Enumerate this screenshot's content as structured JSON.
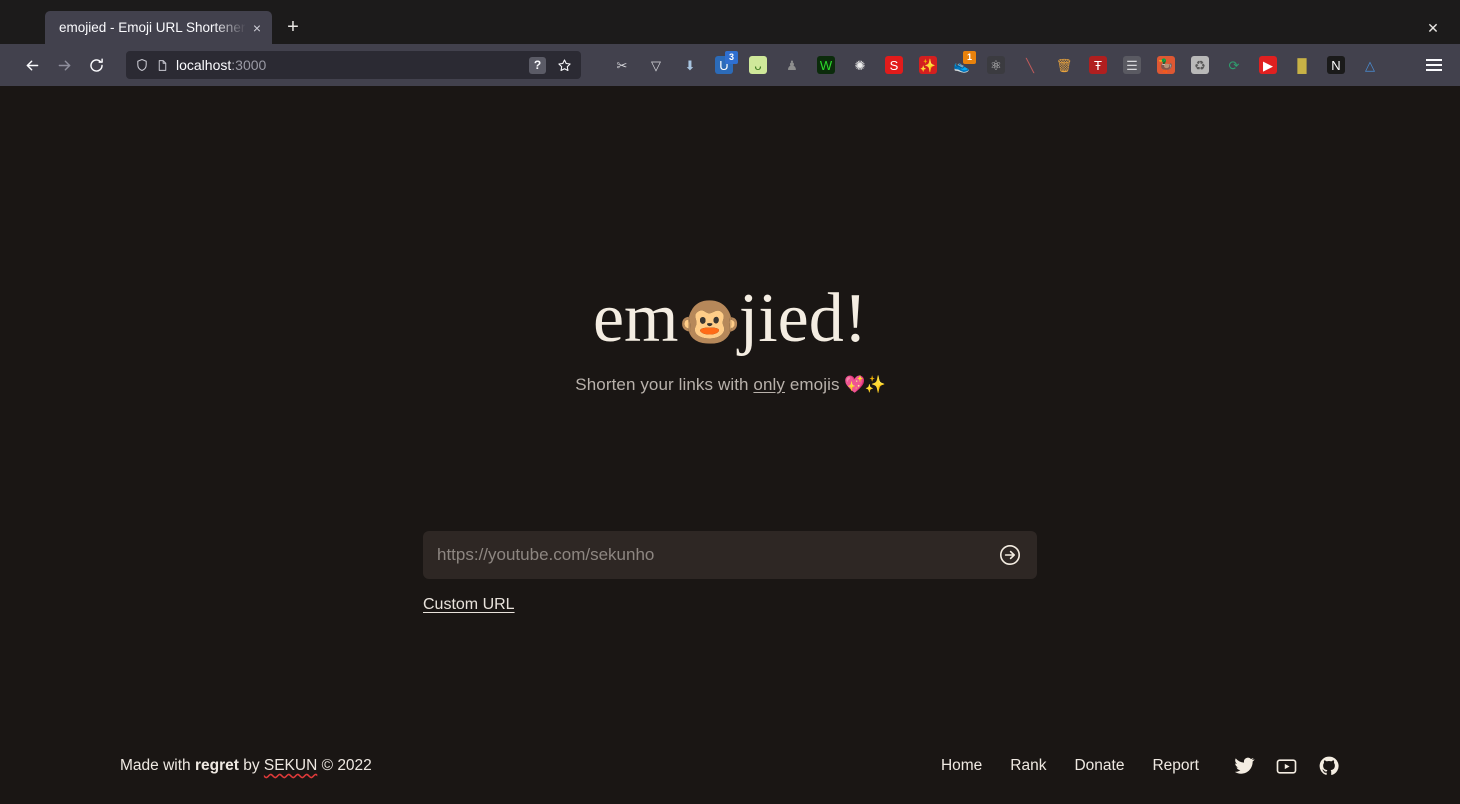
{
  "browser": {
    "tab": {
      "title": "emojied - Emoji URL Shortener",
      "close_label": "×"
    },
    "new_tab_label": "+",
    "window_close_label": "✕",
    "nav": {
      "back_label": "←",
      "forward_label": "→",
      "reload_label": "↻"
    },
    "url": {
      "host": "localhost",
      "port": ":3000",
      "shield_icon": "shield-icon",
      "page_icon": "page-icon",
      "help_badge": "?",
      "bookmark_icon": "star-icon"
    },
    "extensions": [
      {
        "name": "screenshot-tool-icon",
        "glyph": "✂",
        "color": "#d7d7db",
        "bg": "transparent",
        "badge": ""
      },
      {
        "name": "pocket-icon",
        "glyph": "▽",
        "color": "#d7d7db",
        "bg": "transparent",
        "badge": ""
      },
      {
        "name": "downloads-icon",
        "glyph": "⬇",
        "color": "#a8c4e0",
        "bg": "transparent",
        "badge": ""
      },
      {
        "name": "ublock-origin-icon",
        "glyph": "U",
        "color": "#ffffff",
        "bg": "#2c6bb8",
        "badge": "3"
      },
      {
        "name": "sprout-extension-icon",
        "glyph": "ᴗ",
        "color": "#3e7a20",
        "bg": "#cfe89a",
        "badge": ""
      },
      {
        "name": "privacy-badger-icon",
        "glyph": "♟",
        "color": "#8e8e8e",
        "bg": "transparent",
        "badge": ""
      },
      {
        "name": "wappalyzer-icon",
        "glyph": "W",
        "color": "#2bd92b",
        "bg": "#0b2b0b",
        "badge": ""
      },
      {
        "name": "gnome-shell-icon",
        "glyph": "✺",
        "color": "#eeeeee",
        "bg": "transparent",
        "badge": ""
      },
      {
        "name": "sourcegraph-icon",
        "glyph": "S",
        "color": "#ffffff",
        "bg": "#e21b1b",
        "badge": ""
      },
      {
        "name": "magic-wand-icon",
        "glyph": "✨",
        "color": "#ffffff",
        "bg": "#d41f1f",
        "badge": ""
      },
      {
        "name": "shoe-extension-icon",
        "glyph": "👟",
        "color": "#ffffff",
        "bg": "transparent",
        "badge": "1"
      },
      {
        "name": "react-devtools-icon",
        "glyph": "⚛",
        "color": "#cfcfcf",
        "bg": "#3b3b40",
        "badge": ""
      },
      {
        "name": "no-script-icon",
        "glyph": "╲",
        "color": "#c05a5a",
        "bg": "transparent",
        "badge": ""
      },
      {
        "name": "trash-cleaner-icon",
        "glyph": "🗑",
        "color": "#e8a33d",
        "bg": "transparent",
        "badge": ""
      },
      {
        "name": "ublacklist-icon",
        "glyph": "Ŧ",
        "color": "#ffffff",
        "bg": "#b01f1f",
        "badge": ""
      },
      {
        "name": "web-archive-icon",
        "glyph": "☰",
        "color": "#d7d7db",
        "bg": "#5a5a62",
        "badge": ""
      },
      {
        "name": "duckduckgo-icon",
        "glyph": "🦆",
        "color": "#ffffff",
        "bg": "#de5833",
        "badge": ""
      },
      {
        "name": "cookie-autodelete-icon",
        "glyph": "♻",
        "color": "#5a5a5a",
        "bg": "#b9b9b9",
        "badge": ""
      },
      {
        "name": "refresh-extension-icon",
        "glyph": "⟳",
        "color": "#2f9e6e",
        "bg": "transparent",
        "badge": ""
      },
      {
        "name": "youtube-extension-icon",
        "glyph": "▶",
        "color": "#ffffff",
        "bg": "#e02020",
        "badge": ""
      },
      {
        "name": "bookmarks-icon",
        "glyph": "█",
        "color": "#c8b246",
        "bg": "transparent",
        "badge": ""
      },
      {
        "name": "nano-defender-icon",
        "glyph": "N",
        "color": "#ffffff",
        "bg": "#1a1a1a",
        "badge": ""
      },
      {
        "name": "triangle-extension-icon",
        "glyph": "△",
        "color": "#4a90d9",
        "bg": "transparent",
        "badge": ""
      }
    ],
    "menu_label": "open-menu"
  },
  "page": {
    "logo": {
      "before": "em",
      "emoji": "🐵",
      "after": "jied!"
    },
    "tagline": {
      "before": "Shorten your links with ",
      "emphasis": "only",
      "after": " emojis ",
      "emoji": "💖✨"
    },
    "form": {
      "input_value": "",
      "input_placeholder": "https://youtube.com/sekunho",
      "submit_icon": "arrow-right-circle-icon",
      "custom_url_label": "Custom URL"
    },
    "footer": {
      "credits": {
        "prefix": "Made with ",
        "bold": "regret",
        "middle": " by ",
        "author": "SEKUN",
        "suffix": " © 2022"
      },
      "links": [
        {
          "label": "Home",
          "name": "footer-link-home"
        },
        {
          "label": "Rank",
          "name": "footer-link-rank"
        },
        {
          "label": "Donate",
          "name": "footer-link-donate"
        },
        {
          "label": "Report",
          "name": "footer-link-report"
        }
      ],
      "social": [
        {
          "name": "twitter-icon",
          "label": "Twitter"
        },
        {
          "name": "youtube-icon",
          "label": "YouTube"
        },
        {
          "name": "github-icon",
          "label": "GitHub"
        }
      ]
    }
  },
  "colors": {
    "page_bg": "#1a1614",
    "input_bg": "#2e2724",
    "logo_text": "#f4ede2",
    "tagline_text": "#b8b1ab",
    "footer_text": "#efe9e2",
    "spellcheck_underline": "#e03a3a"
  }
}
